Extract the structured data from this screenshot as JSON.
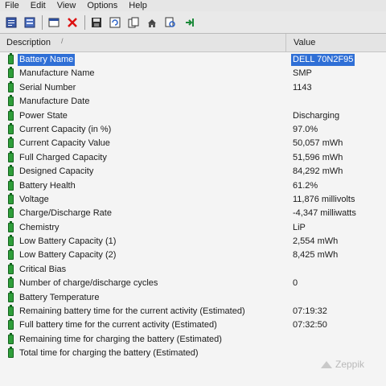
{
  "menu": [
    "File",
    "Edit",
    "View",
    "Options",
    "Help"
  ],
  "toolbar": {
    "icons": [
      "report-icon",
      "list-icon",
      "properties-icon",
      "close-icon",
      "save-icon",
      "refresh-icon",
      "copy-icon",
      "export-icon",
      "find-icon",
      "exit-icon"
    ]
  },
  "table": {
    "col_description": "Description",
    "col_value": "Value",
    "rows": [
      {
        "desc": "Battery Name",
        "value": "DELL 70N2F95"
      },
      {
        "desc": "Manufacture Name",
        "value": "SMP"
      },
      {
        "desc": "Serial Number",
        "value": "1143"
      },
      {
        "desc": "Manufacture Date",
        "value": ""
      },
      {
        "desc": "Power State",
        "value": "Discharging"
      },
      {
        "desc": "Current Capacity (in %)",
        "value": "97.0%"
      },
      {
        "desc": "Current Capacity Value",
        "value": "50,057 mWh"
      },
      {
        "desc": "Full Charged Capacity",
        "value": "51,596 mWh"
      },
      {
        "desc": "Designed Capacity",
        "value": "84,292 mWh"
      },
      {
        "desc": "Battery Health",
        "value": "61.2%"
      },
      {
        "desc": "Voltage",
        "value": "11,876 millivolts"
      },
      {
        "desc": "Charge/Discharge Rate",
        "value": "-4,347 milliwatts"
      },
      {
        "desc": "Chemistry",
        "value": "LiP"
      },
      {
        "desc": "Low Battery Capacity (1)",
        "value": "2,554 mWh"
      },
      {
        "desc": "Low Battery Capacity (2)",
        "value": "8,425 mWh"
      },
      {
        "desc": "Critical Bias",
        "value": ""
      },
      {
        "desc": "Number of charge/discharge cycles",
        "value": "0"
      },
      {
        "desc": "Battery Temperature",
        "value": ""
      },
      {
        "desc": "Remaining battery time for the current activity (Estimated)",
        "value": "07:19:32"
      },
      {
        "desc": "Full battery time for the current activity (Estimated)",
        "value": "07:32:50"
      },
      {
        "desc": "Remaining time for charging the battery (Estimated)",
        "value": ""
      },
      {
        "desc": "Total  time for charging the battery (Estimated)",
        "value": ""
      }
    ]
  },
  "watermark": "Zeppik",
  "colors": {
    "selection": "#2f6fd6",
    "battery": "#2f9e3a"
  }
}
